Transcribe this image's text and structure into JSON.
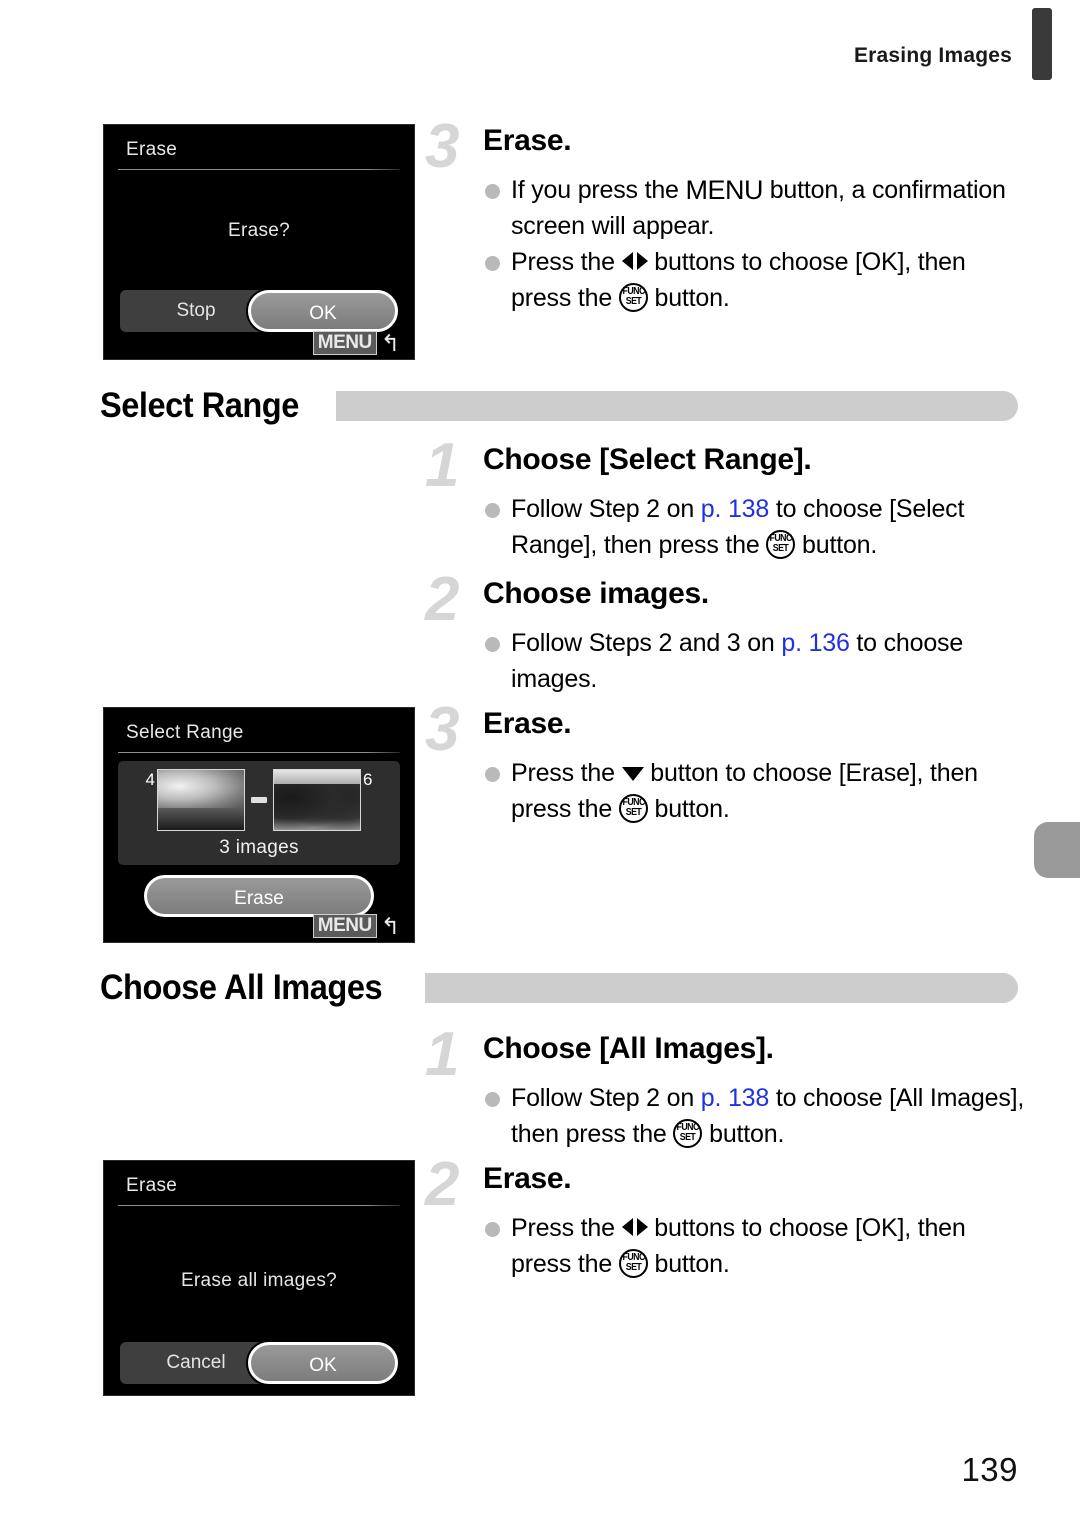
{
  "header": {
    "running_title": "Erasing Images",
    "page_number": "139"
  },
  "screens": [
    {
      "name": "erase-confirm",
      "title": "Erase",
      "message": "Erase?",
      "buttons": {
        "left": "Stop",
        "right": "OK"
      },
      "menu_badge": "MENU"
    },
    {
      "name": "select-range",
      "title": "Select Range",
      "start_number": "4",
      "end_number": "6",
      "count_label": "3 images",
      "action_button": "Erase",
      "menu_badge": "MENU"
    },
    {
      "name": "erase-all-confirm",
      "title": "Erase",
      "message": "Erase all images?",
      "buttons": {
        "left": "Cancel",
        "right": "OK"
      }
    }
  ],
  "sections": [
    {
      "heading": "Select Range"
    },
    {
      "heading": "Choose All Images"
    }
  ],
  "steps": {
    "erase_top": {
      "number": "3",
      "title": "Erase.",
      "b1_a": "If you press the ",
      "b1_menu": "MENU",
      "b1_b": " button, a confirmation screen will appear.",
      "b2_a": "Press the ",
      "b2_b": " buttons to choose [OK], then press the ",
      "b2_c": " button."
    },
    "range_1": {
      "number": "1",
      "title": "Choose [Select Range].",
      "b1_a": "Follow Step 2 on ",
      "b1_ref": "p. 138",
      "b1_b": " to choose [Select Range], then press the ",
      "b1_c": " button."
    },
    "range_2": {
      "number": "2",
      "title": "Choose images.",
      "b1_a": "Follow Steps 2 and 3 on ",
      "b1_ref": "p. 136",
      "b1_b": " to choose images."
    },
    "range_3": {
      "number": "3",
      "title": "Erase.",
      "b1_a": "Press the ",
      "b1_b": " button to choose [Erase], then press the ",
      "b1_c": " button."
    },
    "all_1": {
      "number": "1",
      "title": "Choose [All Images].",
      "b1_a": "Follow Step 2 on ",
      "b1_ref": "p. 138",
      "b1_b": " to choose [All Images], then press the ",
      "b1_c": " button."
    },
    "all_2": {
      "number": "2",
      "title": "Erase.",
      "b1_a": "Press the ",
      "b1_b": " buttons to choose [OK], then press the ",
      "b1_c": " button."
    }
  },
  "icons": {
    "func_set_line1": "FUNC.",
    "func_set_line2": "SET",
    "menu_return": "↰"
  }
}
